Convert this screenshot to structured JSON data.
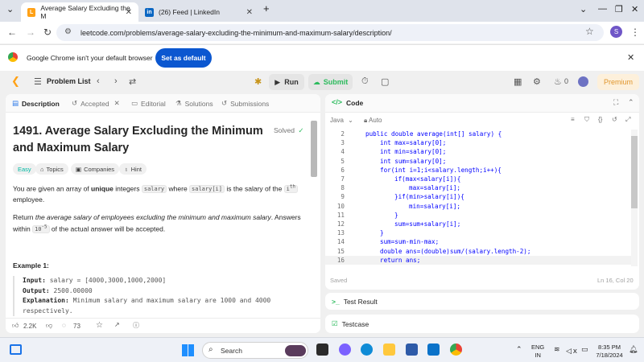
{
  "browser": {
    "tabs": [
      {
        "title": "Average Salary Excluding the M",
        "icon": "leetcode-icon",
        "active": true
      },
      {
        "title": "(26) Feed | LinkedIn",
        "icon": "linkedin-icon",
        "active": false
      }
    ],
    "new_tab": "+",
    "controls": {
      "minimize": "—",
      "maximize": "❐",
      "close": "✕",
      "dropdown": "⌄"
    },
    "url": "leetcode.com/problems/average-salary-excluding-the-minimum-and-maximum-salary/description/",
    "profile_initial": "S"
  },
  "infobar": {
    "message": "Google Chrome isn't your default browser",
    "button": "Set as default"
  },
  "lcnav": {
    "problem_list": "Problem List",
    "run": "Run",
    "submit": "Submit",
    "coins": "0",
    "premium": "Premium"
  },
  "left": {
    "tabs": {
      "description": "Description",
      "accepted": "Accepted",
      "editorial": "Editorial",
      "solutions": "Solutions",
      "submissions": "Submissions"
    },
    "title": "1491. Average Salary Excluding the Minimum and Maximum Salary",
    "solved": "Solved",
    "tags": {
      "difficulty": "Easy",
      "topics": "Topics",
      "companies": "Companies",
      "hint": "Hint"
    },
    "para1": {
      "a": "You are given an array of ",
      "b": "unique",
      "c": " integers ",
      "d": "salary",
      "e": " where ",
      "f": "salary[i]",
      "g": " is the salary of the ",
      "h": "i",
      "sup": "th",
      "i": " employee."
    },
    "para2": {
      "a": "Return ",
      "b": "the average salary of employees excluding the minimum and maximum salary",
      "c": ". Answers within ",
      "d": "10",
      "sup": "-5",
      "e": " of the actual answer will be accepted."
    },
    "example_header": "Example 1:",
    "example": {
      "input_label": "Input:",
      "input": " salary = [4000,3000,1000,2000]",
      "output_label": "Output:",
      "output": " 2500.00000",
      "expl_label": "Explanation:",
      "expl": " Minimum salary and maximum salary are 1000 and 4000 respectively."
    },
    "footer": {
      "likes": "2.2K",
      "comments": "73"
    }
  },
  "right": {
    "header": "Code",
    "language": "Java",
    "autosave": "Auto",
    "code_lines": [
      {
        "n": "2",
        "indent": 0,
        "text": "public double average(int[] salary) {"
      },
      {
        "n": "3",
        "indent": 1,
        "text": "int max=salary[0];"
      },
      {
        "n": "4",
        "indent": 1,
        "text": "int min=salary[0];"
      },
      {
        "n": "5",
        "indent": 1,
        "text": "int sum=salary[0];"
      },
      {
        "n": "6",
        "indent": 1,
        "text": "for(int i=1;i<salary.length;i++){"
      },
      {
        "n": "7",
        "indent": 2,
        "text": "if(max<salary[i]){"
      },
      {
        "n": "8",
        "indent": 3,
        "text": "max=salary[i];"
      },
      {
        "n": "9",
        "indent": 2,
        "text": "}if(min>salary[i]){"
      },
      {
        "n": "10",
        "indent": 3,
        "text": "min=salary[i];"
      },
      {
        "n": "11",
        "indent": 2,
        "text": "}"
      },
      {
        "n": "12",
        "indent": 2,
        "text": "sum=sum+salary[i];"
      },
      {
        "n": "13",
        "indent": 1,
        "text": "}"
      },
      {
        "n": "14",
        "indent": 1,
        "text": "sum=sum-min-max;"
      },
      {
        "n": "15",
        "indent": 1,
        "text": "double ans=(double)sum/(salary.length-2);"
      },
      {
        "n": "16",
        "indent": 1,
        "text": "return ans;"
      }
    ],
    "saved": "Saved",
    "cursor": "Ln 16, Col 20",
    "test_result": "Test Result",
    "testcase": "Testcase"
  },
  "taskbar": {
    "search": "Search",
    "lang1": "ENG",
    "lang2": "IN",
    "time": "8:35 PM",
    "date": "7/18/2024"
  },
  "colors": {
    "accent_blue": "#0b57d0",
    "easy": "#00b8a3",
    "submit_green": "#2cbb5d",
    "premium": "#e0962d"
  }
}
